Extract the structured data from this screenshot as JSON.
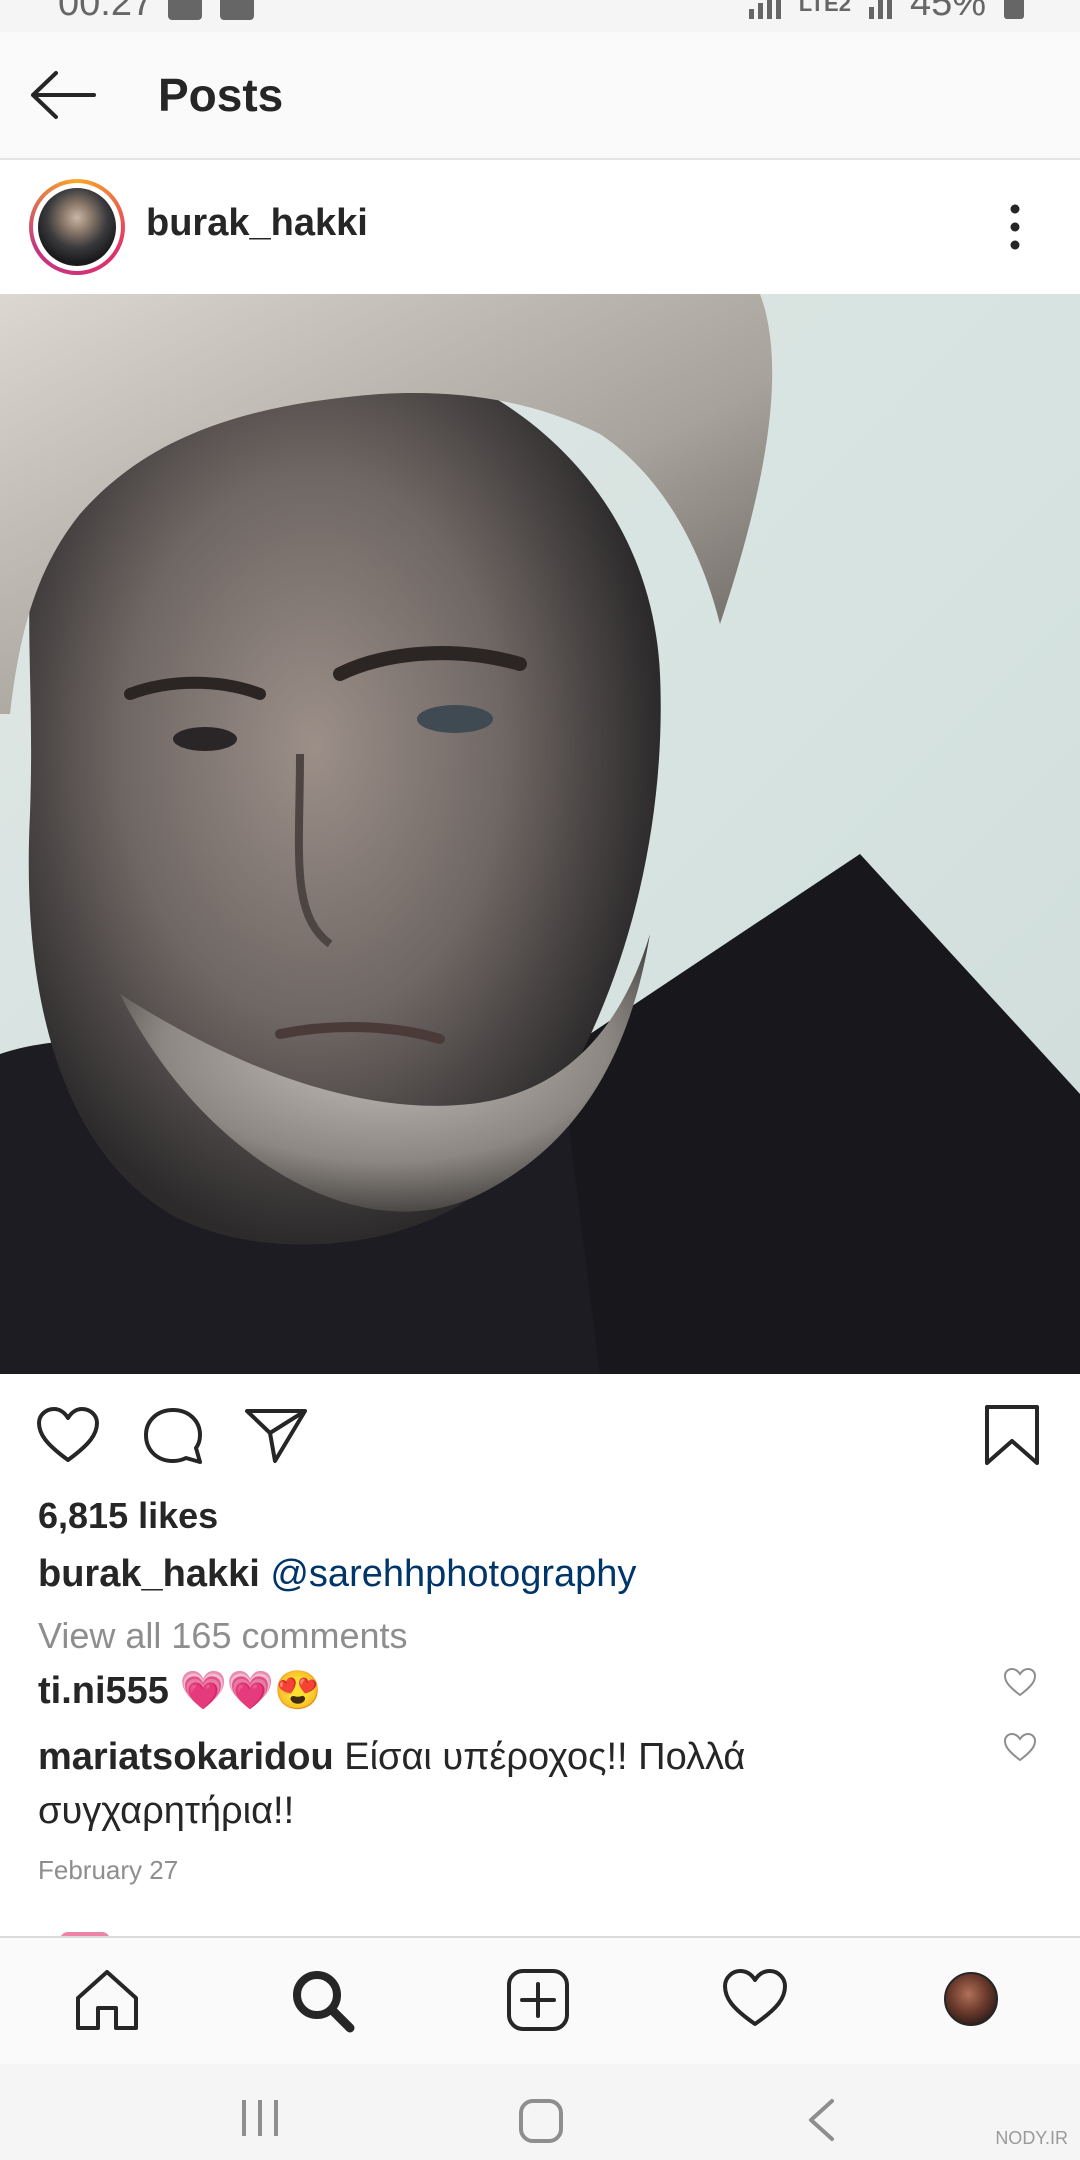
{
  "status_bar": {
    "time": "00:27",
    "network": "LTE2",
    "battery": "45%"
  },
  "app_bar": {
    "title": "Posts",
    "back_icon": "arrow-left-icon"
  },
  "post": {
    "username": "burak_hakki",
    "more_icon": "vertical-dots-icon",
    "likes": "6,815 likes",
    "caption": {
      "username": "burak_hakki",
      "mention": "@sarehhphotography"
    },
    "view_all": "View all 165 comments",
    "comments": [
      {
        "username": "ti.ni555",
        "text": "💗💗😍"
      },
      {
        "username": "mariatsokaridou",
        "text": "Είσαι υπέροχος!! Πολλά συγχαρητήρια!!"
      }
    ],
    "date": "February 27"
  },
  "bottom_nav": {
    "items": [
      "home-icon",
      "search-icon",
      "add-post-icon",
      "activity-heart-icon",
      "profile-avatar"
    ]
  },
  "system_nav": {
    "items": [
      "recent-apps-icon",
      "home-circle-icon",
      "back-chevron-icon"
    ]
  },
  "watermark": "NODY.IR",
  "colors": {
    "mention": "#003569",
    "muted": "#8e8e8e",
    "text": "#262626"
  }
}
